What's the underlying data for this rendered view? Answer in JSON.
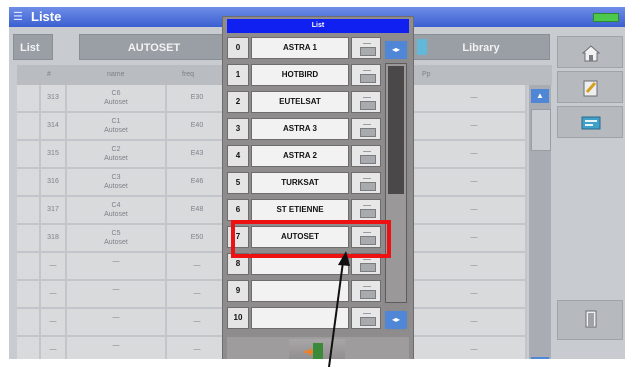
{
  "window": {
    "title": "Liste",
    "icons": {
      "app": "list-icon",
      "battery": "battery-icon"
    },
    "colors": {
      "titlebar": "#3a5fd0",
      "popup_header": "#1020f0",
      "highlight": "#ee1111"
    }
  },
  "tabs": {
    "list": "List",
    "current": "AUTOSET",
    "library": "Library"
  },
  "table": {
    "headers": [
      "#",
      "name",
      "freq",
      "Pp"
    ],
    "rows": [
      {
        "num": "313",
        "name1": "C6",
        "name2": "Autoset",
        "freq": "E30"
      },
      {
        "num": "314",
        "name1": "C1",
        "name2": "Autoset",
        "freq": "E40"
      },
      {
        "num": "315",
        "name1": "C2",
        "name2": "Autoset",
        "freq": "E43"
      },
      {
        "num": "316",
        "name1": "C3",
        "name2": "Autoset",
        "freq": "E46"
      },
      {
        "num": "317",
        "name1": "C4",
        "name2": "Autoset",
        "freq": "E48"
      },
      {
        "num": "318",
        "name1": "C5",
        "name2": "Autoset",
        "freq": "E50"
      },
      {
        "num": "—",
        "name1": "",
        "name2": "—",
        "freq": "—"
      },
      {
        "num": "—",
        "name1": "",
        "name2": "—",
        "freq": "—"
      },
      {
        "num": "—",
        "name1": "",
        "name2": "—",
        "freq": "—"
      },
      {
        "num": "—",
        "name1": "",
        "name2": "—",
        "freq": "—"
      }
    ]
  },
  "popup": {
    "header": "List",
    "items": [
      {
        "index": "0",
        "name": "ASTRA 1"
      },
      {
        "index": "1",
        "name": "HOTBIRD"
      },
      {
        "index": "2",
        "name": "EUTELSAT"
      },
      {
        "index": "3",
        "name": "ASTRA 3"
      },
      {
        "index": "4",
        "name": "ASTRA 2"
      },
      {
        "index": "5",
        "name": "TURKSAT"
      },
      {
        "index": "6",
        "name": "ST ETIENNE"
      },
      {
        "index": "7",
        "name": "AUTOSET"
      },
      {
        "index": "8",
        "name": ""
      },
      {
        "index": "9",
        "name": ""
      },
      {
        "index": "10",
        "name": ""
      }
    ],
    "selected_index": "7",
    "edit_icon": "keyboard-icon",
    "exit_icon": "exit-door-icon"
  },
  "sidebar": {
    "icons": [
      "home-icon",
      "edit-icon",
      "satellite-list-icon",
      "exit-door-icon"
    ]
  }
}
